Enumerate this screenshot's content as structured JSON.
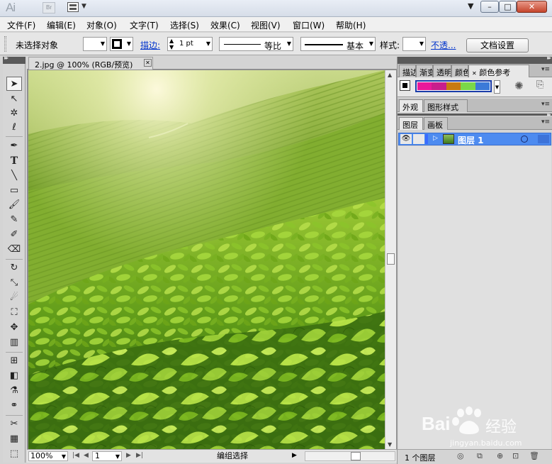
{
  "app": {
    "logo_text": "Ai",
    "bridge_label": "Br"
  },
  "menu": [
    "文件(F)",
    "编辑(E)",
    "对象(O)",
    "文字(T)",
    "选择(S)",
    "效果(C)",
    "视图(V)",
    "窗口(W)",
    "帮助(H)"
  ],
  "control_bar": {
    "selection_status": "未选择对象",
    "stroke_label": "描边:",
    "stroke_weight": "1 pt",
    "profile_label": "等比",
    "brush_label": "基本",
    "style_label": "样式:",
    "opacity_link": "不透...",
    "doc_settings_button": "文档设置"
  },
  "document": {
    "tab_title": "2.jpg @ 100% (RGB/预览)",
    "zoom": "100%",
    "artboard": "1",
    "status": "编组选择"
  },
  "tools": [
    "selection-tool",
    "direct-selection-tool",
    "magic-wand-tool",
    "lasso-tool",
    "pen-tool",
    "type-tool",
    "line-tool",
    "rectangle-tool",
    "paintbrush-tool",
    "pencil-tool",
    "blob-brush-tool",
    "eraser-tool",
    "rotate-tool",
    "scale-tool",
    "warp-tool",
    "free-transform-tool",
    "symbol-sprayer-tool",
    "column-graph-tool",
    "mesh-tool",
    "gradient-tool",
    "eyedropper-tool",
    "blend-tool",
    "slice-tool",
    "chart-tool",
    "artboard-tool"
  ],
  "panels": {
    "group1_tabs": [
      "描边",
      "渐变",
      "透明",
      "颜色",
      "颜色参考"
    ],
    "color_guide_colors": [
      "#e8189a",
      "#c81e8c",
      "#c87a10",
      "#7ad848",
      "#3c7ad8"
    ],
    "group2_tabs": [
      "外观",
      "图形样式"
    ],
    "group3_tabs": [
      "图层",
      "画板"
    ],
    "layer_name": "图层 1",
    "layer_count": "1 个图层"
  },
  "watermark": {
    "brand": "Bai",
    "brand2": "经验",
    "url": "jingyan.baidu.com"
  },
  "colors": {
    "selection_blue": "#4d8bf0",
    "link_blue": "#0033cc",
    "close_red": "#c5452c"
  }
}
